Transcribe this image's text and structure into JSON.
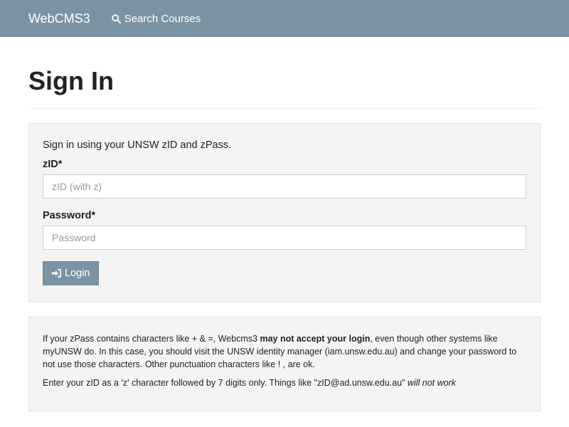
{
  "navbar": {
    "brand": "WebCMS3",
    "search_label": "Search Courses",
    "background": "#7c93a3"
  },
  "page": {
    "title": "Sign In"
  },
  "login_form": {
    "intro": "Sign in using your UNSW zID and zPass.",
    "zid_label": "zID*",
    "zid_placeholder": "zID (with z)",
    "zid_value": "",
    "password_label": "Password*",
    "password_placeholder": "Password",
    "password_value": "",
    "submit_label": "Login"
  },
  "notice": {
    "p1_part1": "If your zPass contains characters like + & =, Webcms3 ",
    "p1_bold": "may not accept your login",
    "p1_part2": ", even though other systems like myUNSW do. In this case, you should visit the UNSW identity manager (iam.unsw.edu.au) and change your password to not use those characters. Other punctuation characters like ! , are ok.",
    "p2_part1": "Enter your zID as a 'z' character followed by 7 digits only. Things like \"zID@ad.unsw.edu.au\" ",
    "p2_italic": "will not work"
  },
  "icons": {
    "search": "search-icon",
    "login": "sign-in-icon"
  }
}
